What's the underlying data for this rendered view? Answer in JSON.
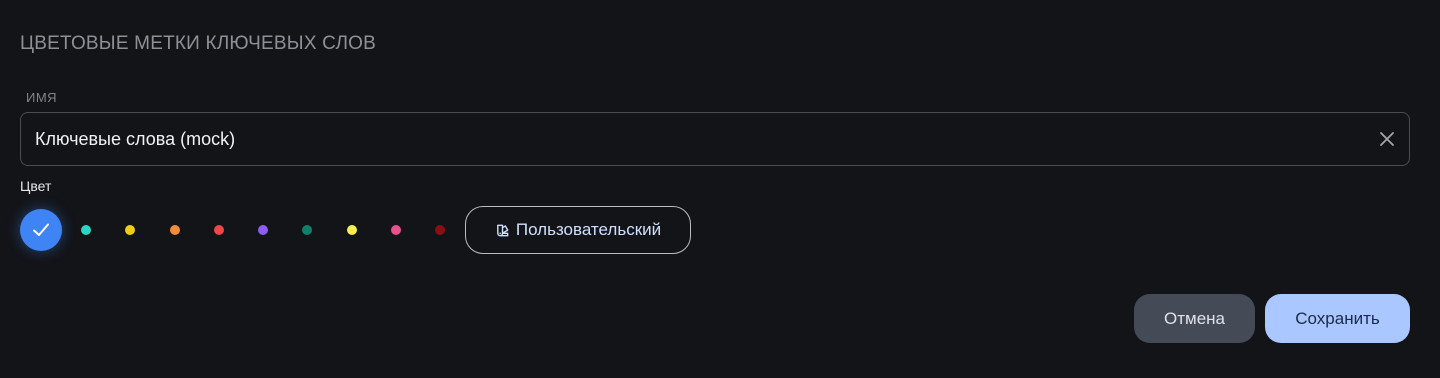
{
  "dialog": {
    "title": "ЦВЕТОВЫЕ МЕТКИ КЛЮЧЕВЫХ СЛОВ"
  },
  "name_field": {
    "label": "ИМЯ",
    "value": "Ключевые слова (mock)",
    "clear_icon": "close-icon"
  },
  "color": {
    "label": "Цвет",
    "selected": "#3f84f5",
    "swatches": [
      "#3f84f5",
      "#2bd4c3",
      "#f2cc12",
      "#f28c38",
      "#ef4646",
      "#8b5cf6",
      "#10806a",
      "#f6ee4f",
      "#ec4f8e",
      "#8b0f12"
    ],
    "custom_button": {
      "icon": "palette-icon",
      "label": "Пользовательский"
    }
  },
  "actions": {
    "cancel_label": "Отмена",
    "save_label": "Сохранить"
  }
}
